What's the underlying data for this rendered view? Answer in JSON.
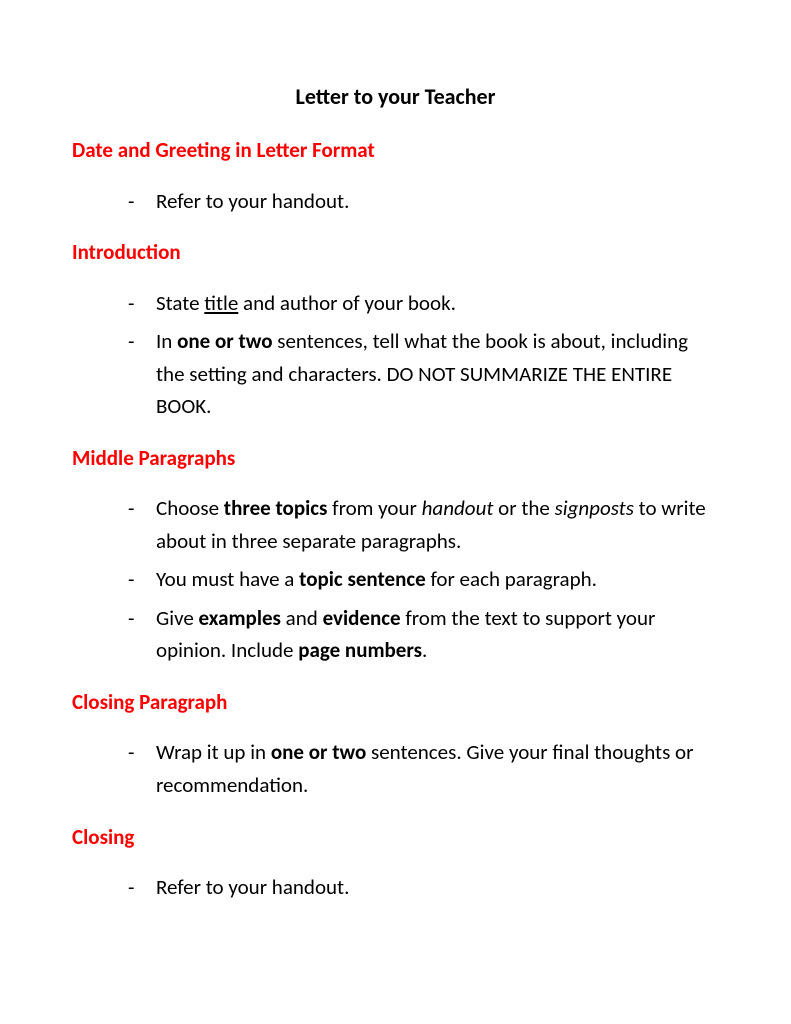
{
  "title": "Letter to your Teacher",
  "sections": [
    {
      "heading": "Date and Greeting in Letter Format",
      "items": [
        {
          "parts": [
            {
              "t": "Refer to your handout."
            }
          ]
        }
      ]
    },
    {
      "heading": "Introduction",
      "items": [
        {
          "parts": [
            {
              "t": "State "
            },
            {
              "t": "title",
              "u": true
            },
            {
              "t": " and author of your book."
            }
          ]
        },
        {
          "parts": [
            {
              "t": "In "
            },
            {
              "t": "one or two",
              "b": true
            },
            {
              "t": " sentences, tell what the book is about, including the setting and characters.  DO NOT SUMMARIZE THE ENTIRE BOOK."
            }
          ]
        }
      ]
    },
    {
      "heading": "Middle Paragraphs",
      "items": [
        {
          "parts": [
            {
              "t": "Choose "
            },
            {
              "t": "three topics",
              "b": true
            },
            {
              "t": " from your "
            },
            {
              "t": "handout",
              "i": true
            },
            {
              "t": " or the "
            },
            {
              "t": "signposts",
              "i": true
            },
            {
              "t": " to write about in three separate paragraphs."
            }
          ]
        },
        {
          "parts": [
            {
              "t": "You must have a "
            },
            {
              "t": "topic sentence",
              "b": true
            },
            {
              "t": " for each paragraph."
            }
          ]
        },
        {
          "parts": [
            {
              "t": "Give "
            },
            {
              "t": "examples",
              "b": true
            },
            {
              "t": " and "
            },
            {
              "t": "evidence",
              "b": true
            },
            {
              "t": " from the text to support your opinion.  Include "
            },
            {
              "t": "page numbers",
              "b": true
            },
            {
              "t": "."
            }
          ]
        }
      ]
    },
    {
      "heading": "Closing Paragraph",
      "items": [
        {
          "parts": [
            {
              "t": "Wrap it up in "
            },
            {
              "t": "one or two",
              "b": true
            },
            {
              "t": " sentences.  Give your final thoughts or recommendation."
            }
          ]
        }
      ]
    },
    {
      "heading": "Closing",
      "items": [
        {
          "parts": [
            {
              "t": "Refer to your handout."
            }
          ]
        }
      ]
    }
  ]
}
